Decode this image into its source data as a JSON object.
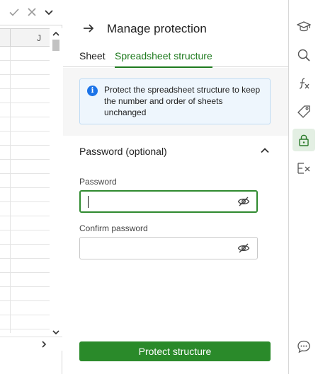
{
  "spreadsheet": {
    "column_label": "J"
  },
  "panel": {
    "title": "Manage protection",
    "tabs": [
      {
        "label": "Sheet",
        "active": false
      },
      {
        "label": "Spreadsheet structure",
        "active": true
      }
    ],
    "info_text": "Protect the spreadsheet structure to keep the number and order of sheets unchanged",
    "section": {
      "title": "Password (optional)",
      "expanded": true
    },
    "password": {
      "label": "Password",
      "value": ""
    },
    "confirm_password": {
      "label": "Confirm password",
      "value": ""
    },
    "primary_button": "Protect structure"
  },
  "rail": {
    "items": [
      {
        "icon": "graduation-cap-icon",
        "active": false
      },
      {
        "icon": "search-icon",
        "active": false
      },
      {
        "icon": "function-icon",
        "active": false
      },
      {
        "icon": "tag-icon",
        "active": false
      },
      {
        "icon": "lock-icon",
        "active": true
      },
      {
        "icon": "clear-formatting-icon",
        "active": false
      },
      {
        "icon": "chat-icon",
        "active": false
      }
    ]
  },
  "colors": {
    "accent": "#2a8a2a",
    "info_bg": "#eef6fd",
    "info_icon": "#1a73e8"
  }
}
